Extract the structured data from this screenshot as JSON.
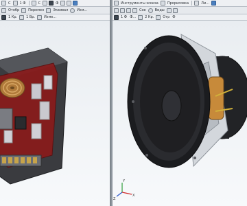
{
  "left_pane": {
    "toolbar_row1": {
      "labels": [
        "C",
        "1 Ф",
        "C",
        "Ф"
      ]
    },
    "toolbar_row2": {
      "labels": [
        "Отобр",
        "Перемен",
        "Эквивал",
        "Изм..."
      ]
    },
    "toolbar_row3": {
      "labels": [
        "1 Кр.",
        "1 Вр.",
        "Изме..."
      ]
    }
  },
  "right_pane": {
    "toolbar_row1": {
      "labels": [
        "Инструменты эскиза",
        "Прорисовка",
        "Ли..."
      ]
    },
    "toolbar_row2": {
      "labels": [
        "Сое",
        "Виды"
      ]
    },
    "toolbar_row3": {
      "labels": [
        "1 Ф",
        "Ф...",
        "2 Кр.",
        "Отр",
        "Ф"
      ]
    },
    "axes": {
      "x_label": "X",
      "y_label": "Y",
      "z_label": "Z"
    }
  },
  "colors": {
    "viewport_top": "#e9edf1",
    "board_red": "#8b1a1a",
    "speaker_basket": "#c9cdd2",
    "cone_dark": "#1f1f22",
    "magnet": "#222326",
    "copper": "#c78a3a"
  }
}
